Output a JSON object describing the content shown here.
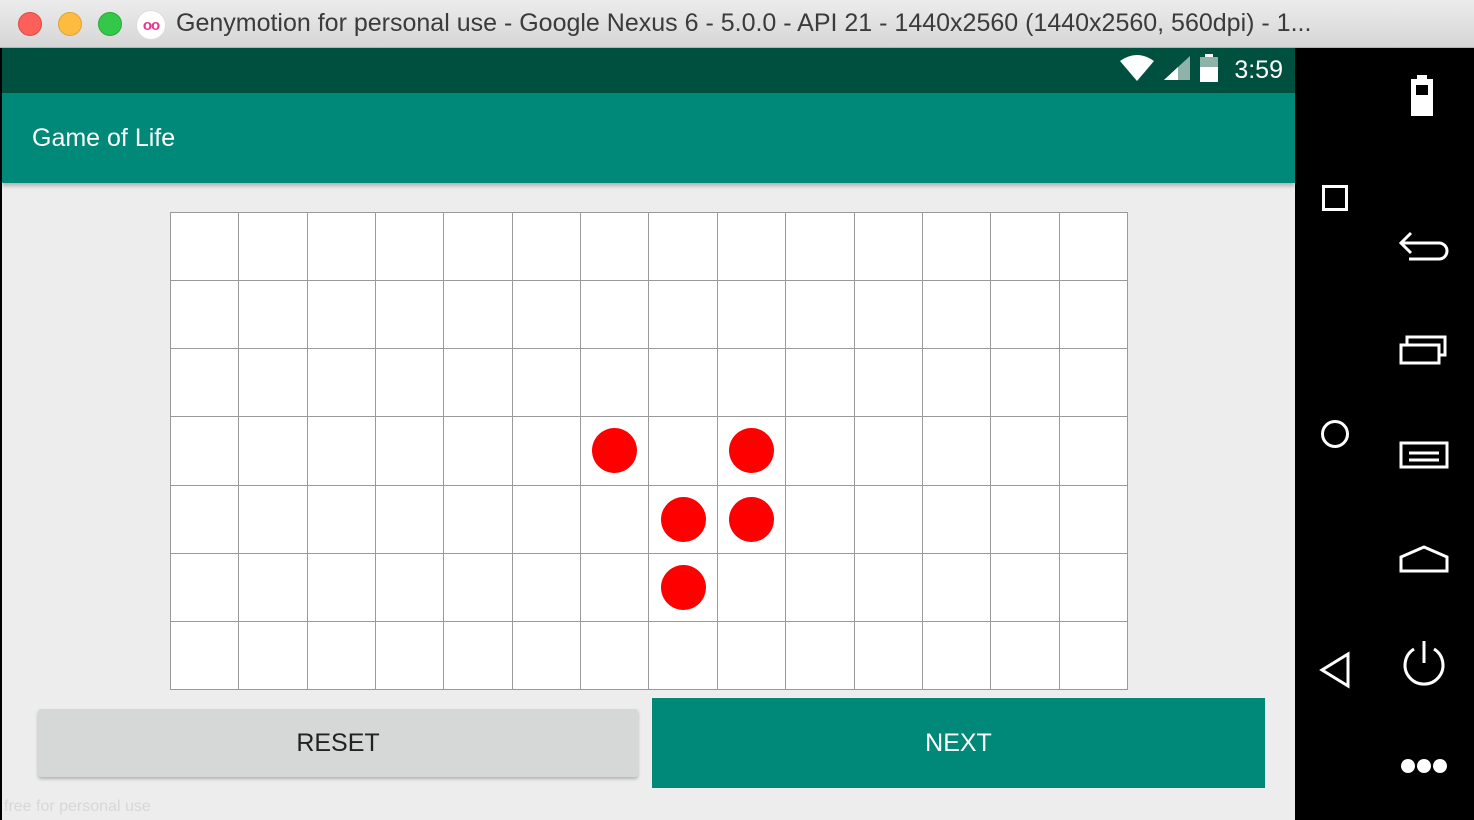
{
  "window": {
    "title": "Genymotion for personal use - Google Nexus 6 - 5.0.0 - API 21 - 1440x2560 (1440x2560, 560dpi) - 1...",
    "logo_text": "oo"
  },
  "statusbar": {
    "time": "3:59"
  },
  "app": {
    "title": "Game of Life"
  },
  "board": {
    "columns": 14,
    "rows": 7,
    "live_cells": [
      [
        3,
        6
      ],
      [
        3,
        8
      ],
      [
        4,
        7
      ],
      [
        4,
        8
      ],
      [
        5,
        7
      ]
    ],
    "live_color": "#ff0000"
  },
  "buttons": {
    "reset_label": "RESET",
    "next_label": "NEXT"
  },
  "watermark": "free for personal use",
  "colors": {
    "accent": "#008878",
    "statusbar": "#00503f"
  },
  "sidebar": {
    "icons": [
      "battery-icon",
      "recent-square-icon",
      "back-arrow-icon",
      "recent-apps-icon",
      "home-circle-icon",
      "menu-icon",
      "triangle-back-icon",
      "home-icon",
      "power-icon",
      "more-icon"
    ]
  }
}
